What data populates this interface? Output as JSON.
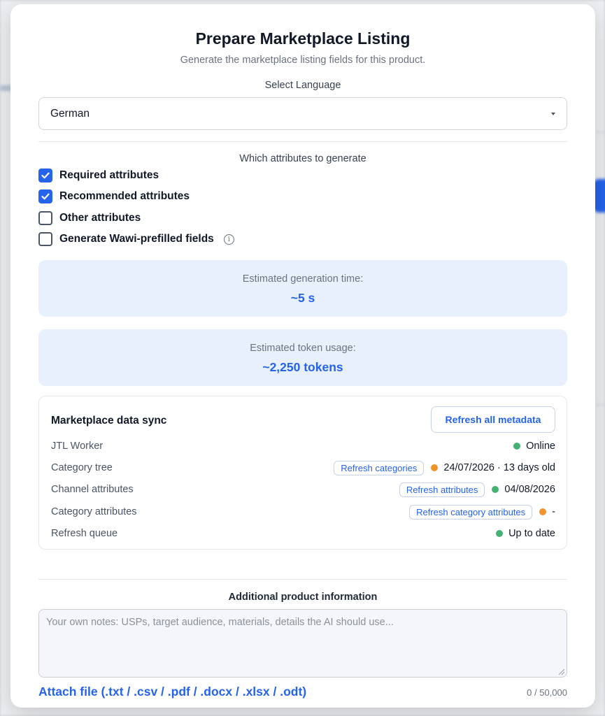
{
  "modal": {
    "title": "Prepare Marketplace Listing",
    "subtitle": "Generate the marketplace listing fields for this product.",
    "language_label": "Select Language",
    "language_value": "German",
    "attributes_label": "Which attributes to generate",
    "attributes": [
      {
        "label": "Required attributes",
        "checked": true
      },
      {
        "label": "Recommended attributes",
        "checked": true
      },
      {
        "label": "Other attributes",
        "checked": false
      },
      {
        "label": "Generate Wawi-prefilled fields",
        "checked": false
      }
    ],
    "estimates": {
      "time_label": "Estimated generation time:",
      "time_value": "~5 s",
      "token_label": "Estimated token usage:",
      "token_value": "~2,250 tokens"
    },
    "sync": {
      "title": "Marketplace data sync",
      "refresh_all_label": "Refresh all metadata",
      "rows": [
        {
          "name": "JTL Worker",
          "button": "",
          "status_color": "green",
          "status": "Online"
        },
        {
          "name": "Category tree",
          "button": "Refresh categories",
          "status_color": "orange",
          "status": "24/07/2026 · 13 days old"
        },
        {
          "name": "Channel attributes",
          "button": "Refresh attributes",
          "status_color": "green",
          "status": "04/08/2026"
        },
        {
          "name": "Category attributes",
          "button": "Refresh category attributes",
          "status_color": "orange",
          "status": "-"
        },
        {
          "name": "Refresh queue",
          "button": "",
          "status_color": "green",
          "status": "Up to date"
        }
      ]
    },
    "additional_label": "Additional product information",
    "notes_placeholder": "Your own notes: USPs, target audience, materials, details the AI should use...",
    "attach_label": "Attach file (.txt / .csv / .pdf / .docx / .xlsx / .odt)",
    "char_count": "0 / 50,000"
  },
  "colors": {
    "accent": "#2563eb",
    "status_green": "#22a55a",
    "status_orange": "#f0932b",
    "estimate_bg": "#e8f0fd"
  }
}
